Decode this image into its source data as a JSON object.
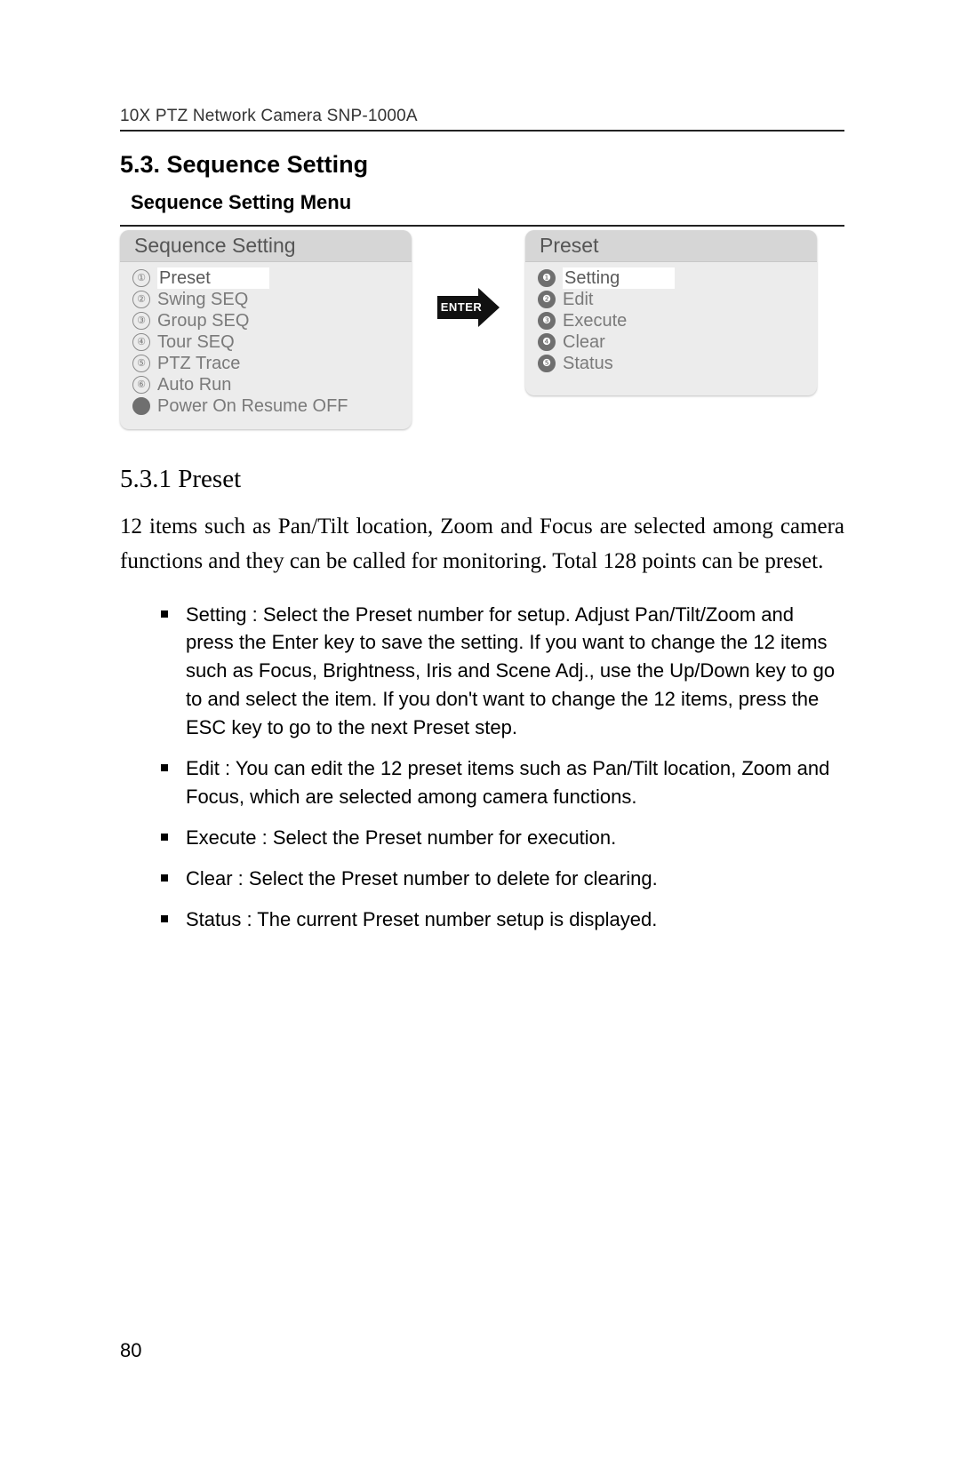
{
  "header": "10X PTZ Network Camera SNP-1000A",
  "section_title": "5.3. Sequence Setting",
  "section_subtitle": "Sequence Setting Menu",
  "left_panel": {
    "title": "Sequence Setting",
    "items": [
      {
        "marker": "①",
        "label": "Preset",
        "highlight": true
      },
      {
        "marker": "②",
        "label": "Swing SEQ",
        "highlight": false
      },
      {
        "marker": "③",
        "label": "Group SEQ",
        "highlight": false
      },
      {
        "marker": "④",
        "label": "Tour SEQ",
        "highlight": false
      },
      {
        "marker": "⑤",
        "label": "PTZ Trace",
        "highlight": false
      },
      {
        "marker": "⑥",
        "label": "Auto Run",
        "highlight": false
      },
      {
        "marker": "●",
        "label": "Power On Resume OFF",
        "filled": true
      }
    ]
  },
  "arrow_label": "ENTER",
  "right_panel": {
    "title": "Preset",
    "items": [
      {
        "marker": "❶",
        "label": "Setting",
        "highlight": true
      },
      {
        "marker": "❷",
        "label": "Edit"
      },
      {
        "marker": "❸",
        "label": "Execute"
      },
      {
        "marker": "❹",
        "label": "Clear"
      },
      {
        "marker": "❺",
        "label": "Status"
      }
    ]
  },
  "subsection_title": "5.3.1 Preset",
  "paragraph": "12 items such as Pan/Tilt location, Zoom and Focus are selected among camera functions and they can be called for monitoring. Total 128 points can be preset.",
  "bullets": [
    "Setting : Select the Preset number for setup. Adjust Pan/Tilt/Zoom and press the Enter key to save the setting. If you want to change the 12 items such as Focus, Brightness, Iris and Scene Adj., use the Up/Down key to go to and select the item. If you don't want to change the 12 items, press the ESC key to go to the next Preset step.",
    "Edit : You can edit the 12 preset items such as Pan/Tilt location, Zoom and Focus, which are selected among camera functions.",
    "Execute : Select the Preset number for execution.",
    "Clear : Select the Preset number to delete for clearing.",
    "Status : The current Preset number setup is displayed."
  ],
  "page_number": "80"
}
